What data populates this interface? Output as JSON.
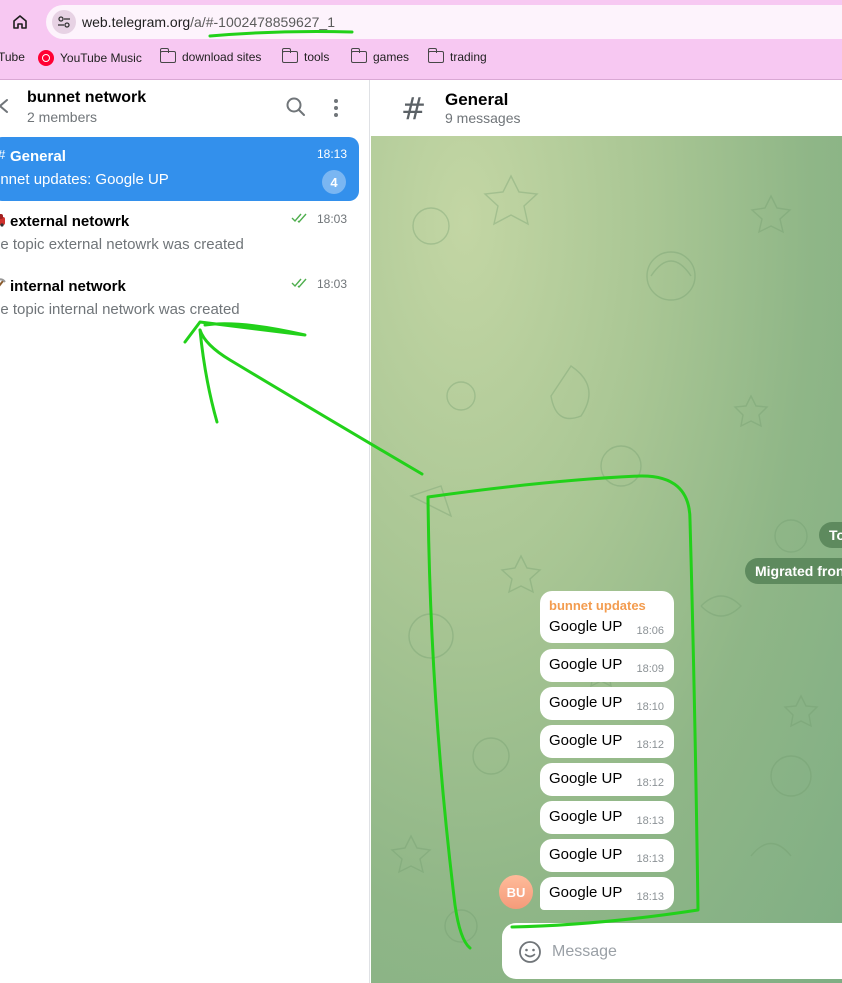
{
  "browser": {
    "url_host": "web.telegram.org",
    "url_path": "/a/#-1002478859627_1",
    "bookmarks": [
      {
        "label": "Tube",
        "icon": "youtube-icon"
      },
      {
        "label": "YouTube Music",
        "icon": "youtube-music-icon"
      },
      {
        "label": "download sites",
        "icon": "folder-icon"
      },
      {
        "label": "tools",
        "icon": "folder-icon"
      },
      {
        "label": "games",
        "icon": "folder-icon"
      },
      {
        "label": "trading",
        "icon": "folder-icon"
      }
    ]
  },
  "sidebar": {
    "title": "bunnet network",
    "members": "2 members",
    "topics": [
      {
        "icon": "hash-icon",
        "title": "General",
        "preview": "unnet updates: Google UP",
        "time": "18:13",
        "unread": "4",
        "active": true
      },
      {
        "icon": "car-emoji-icon",
        "title": "external netowrk",
        "preview": "he topic external netowrk was created",
        "time": "18:03",
        "read": true
      },
      {
        "icon": "pick-emoji-icon",
        "title": "internal network",
        "preview": "he topic internal network was created",
        "time": "18:03",
        "read": true
      }
    ]
  },
  "chat": {
    "title": "General",
    "subtitle": "9 messages",
    "system_pills": [
      "To",
      "Migrated fron"
    ],
    "messages": [
      {
        "sender": "bunnet updates",
        "text": "Google UP",
        "time": "18:06"
      },
      {
        "text": "Google UP",
        "time": "18:09"
      },
      {
        "text": "Google UP",
        "time": "18:10"
      },
      {
        "text": "Google UP",
        "time": "18:12"
      },
      {
        "text": "Google UP",
        "time": "18:12"
      },
      {
        "text": "Google UP",
        "time": "18:13"
      },
      {
        "text": "Google UP",
        "time": "18:13"
      },
      {
        "text": "Google UP",
        "time": "18:13"
      }
    ],
    "avatar_initials": "BU",
    "composer_placeholder": "Message"
  },
  "colors": {
    "browser_chrome": "#f7c8f2",
    "active_topic": "#3390ec",
    "sender_name": "#f39c4f",
    "annotation_green": "#22d11a"
  }
}
